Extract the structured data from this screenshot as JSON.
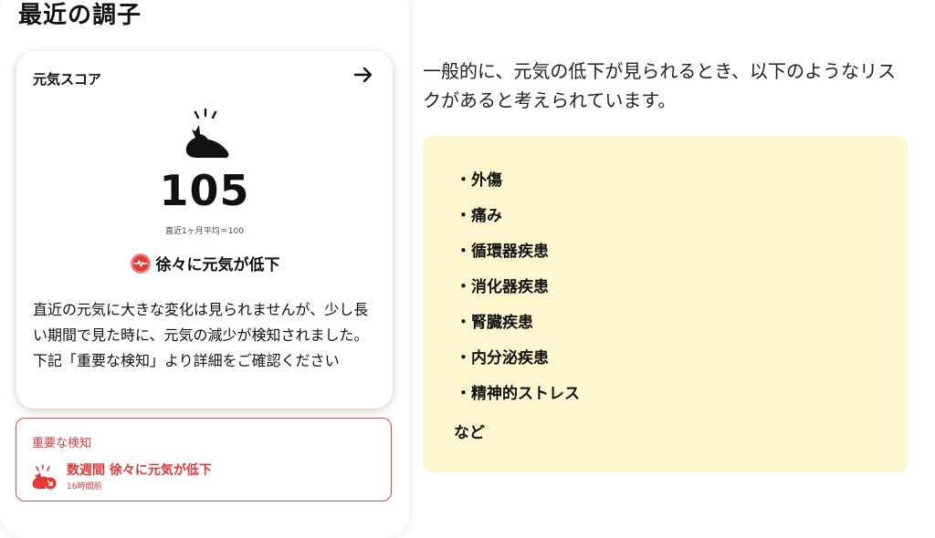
{
  "section": {
    "title": "最近の調子"
  },
  "score_card": {
    "label": "元気スコア",
    "value": "105",
    "average_note": "直近1ヶ月平均＝100",
    "trend_label": "徐々に元気が低下",
    "description": "直近の元気に大きな変化は見られませんが、少し長い期間で見た時に、元気の減少が検知されました。下記「重要な検知」より詳細をご確認ください"
  },
  "alert": {
    "title": "重要な検知",
    "headline": "数週間 徐々に元気が低下",
    "time": "16時間前"
  },
  "info": {
    "intro": "一般的に、元気の低下が見られるとき、以下のようなリスクがあると考えられています。",
    "risks": [
      "・外傷",
      "・痛み",
      "・循環器疾患",
      "・消化器疾患",
      "・腎臓疾患",
      "・内分泌疾患",
      "・精神的ストレス"
    ],
    "more": "など"
  },
  "colors": {
    "alert_red": "#e53935",
    "risk_box_bg": "#fef6cf"
  },
  "icons": {
    "arrow": "arrow-right-icon",
    "cat": "sad-cat-icon",
    "pulse": "heartbeat-icon",
    "alert": "cat-decline-icon"
  }
}
